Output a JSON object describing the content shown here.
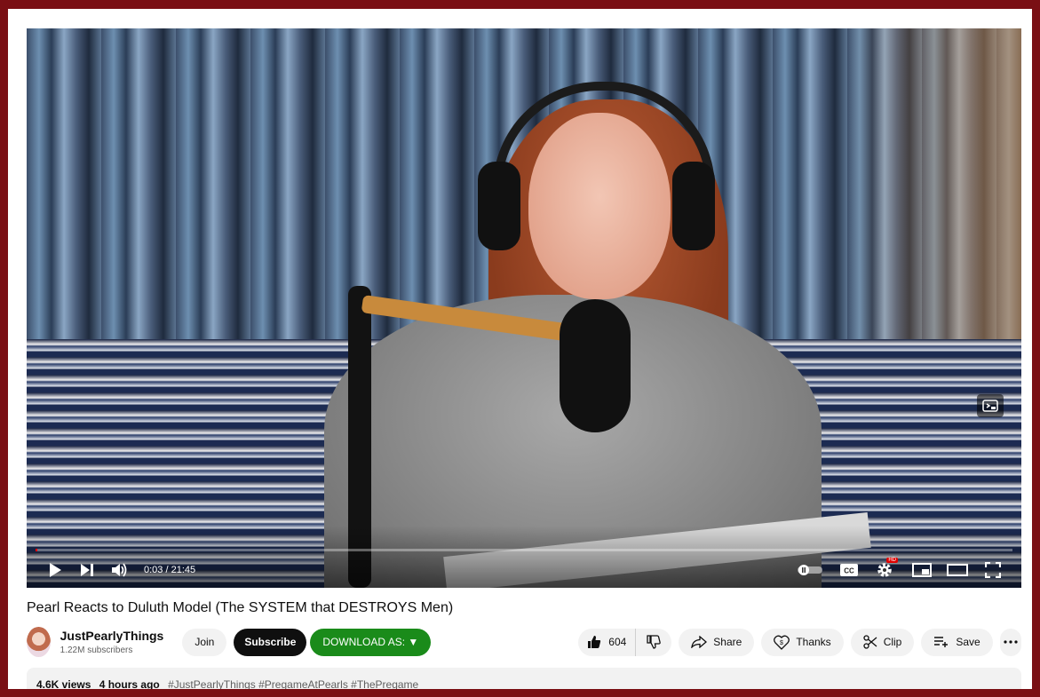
{
  "video": {
    "current_time": "0:03",
    "duration": "21:45",
    "time_display": "0:03 / 21:45",
    "progress_fraction": 0.002
  },
  "title": "Pearl Reacts to Duluth Model (The SYSTEM that DESTROYS Men)",
  "channel": {
    "name": "JustPearlyThings",
    "subscribers": "1.22M subscribers"
  },
  "buttons": {
    "join": "Join",
    "subscribe": "Subscribe",
    "download": "DOWNLOAD AS: ▼",
    "like_count": "604",
    "share": "Share",
    "thanks": "Thanks",
    "clip": "Clip",
    "save": "Save"
  },
  "description": {
    "views": "4.6K views",
    "age": "4 hours ago",
    "hashtags": "#JustPearlyThings #PregameAtPearls #ThePregame"
  },
  "icons": {
    "play": "play-icon",
    "next": "next-icon",
    "volume": "volume-icon",
    "autoplay": "autoplay-toggle-icon",
    "cc": "captions-icon",
    "settings": "settings-gear-icon",
    "miniplayer": "miniplayer-icon",
    "theater": "theater-mode-icon",
    "fullscreen": "fullscreen-icon",
    "like": "thumbs-up-icon",
    "dislike": "thumbs-down-icon",
    "share": "share-arrow-icon",
    "thanks": "thanks-heart-icon",
    "clip": "scissors-icon",
    "save": "playlist-add-icon",
    "more": "more-horizontal-icon"
  },
  "colors": {
    "frame": "#7a0f14",
    "download_green": "#1a8b1a",
    "progress_red": "#ff0000",
    "hd_badge": "#e00000"
  }
}
